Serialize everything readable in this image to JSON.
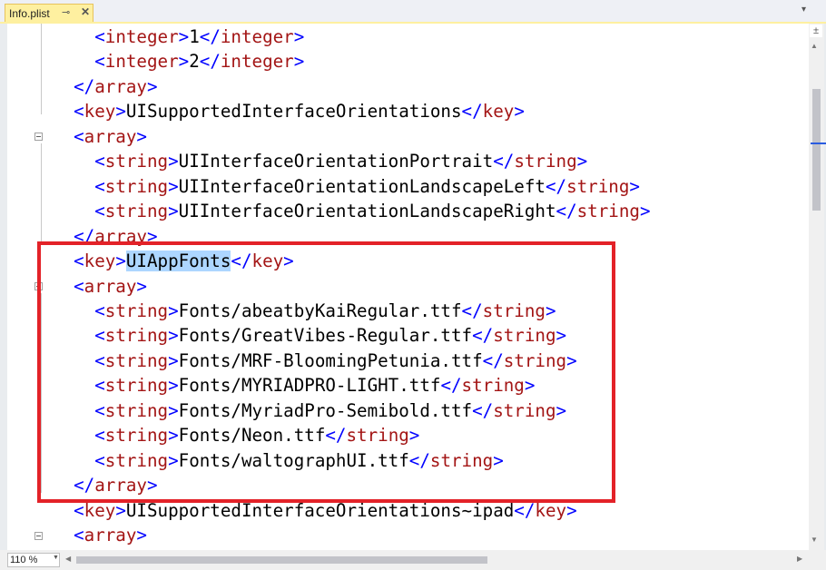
{
  "tab": {
    "title": "Info.plist",
    "pin": "⊸",
    "close": "✕"
  },
  "dropdown": "▾",
  "zoom": {
    "value": "110 %"
  },
  "splitter": "±",
  "code": {
    "lines": [
      [
        [
          "bl",
          "    <"
        ],
        [
          "tg",
          "integer"
        ],
        [
          "bl",
          ">"
        ],
        [
          "tx",
          "1"
        ],
        [
          "bl",
          "</"
        ],
        [
          "tg",
          "integer"
        ],
        [
          "bl",
          ">"
        ]
      ],
      [
        [
          "bl",
          "    <"
        ],
        [
          "tg",
          "integer"
        ],
        [
          "bl",
          ">"
        ],
        [
          "tx",
          "2"
        ],
        [
          "bl",
          "</"
        ],
        [
          "tg",
          "integer"
        ],
        [
          "bl",
          ">"
        ]
      ],
      [
        [
          "bl",
          "  </"
        ],
        [
          "tg",
          "array"
        ],
        [
          "bl",
          ">"
        ]
      ],
      [
        [
          "bl",
          "  <"
        ],
        [
          "tg",
          "key"
        ],
        [
          "bl",
          ">"
        ],
        [
          "tx",
          "UISupportedInterfaceOrientations"
        ],
        [
          "bl",
          "</"
        ],
        [
          "tg",
          "key"
        ],
        [
          "bl",
          ">"
        ]
      ],
      [
        [
          "bl",
          "  <"
        ],
        [
          "tg",
          "array"
        ],
        [
          "bl",
          ">"
        ]
      ],
      [
        [
          "bl",
          "    <"
        ],
        [
          "tg",
          "string"
        ],
        [
          "bl",
          ">"
        ],
        [
          "tx",
          "UIInterfaceOrientationPortrait"
        ],
        [
          "bl",
          "</"
        ],
        [
          "tg",
          "string"
        ],
        [
          "bl",
          ">"
        ]
      ],
      [
        [
          "bl",
          "    <"
        ],
        [
          "tg",
          "string"
        ],
        [
          "bl",
          ">"
        ],
        [
          "tx",
          "UIInterfaceOrientationLandscapeLeft"
        ],
        [
          "bl",
          "</"
        ],
        [
          "tg",
          "string"
        ],
        [
          "bl",
          ">"
        ]
      ],
      [
        [
          "bl",
          "    <"
        ],
        [
          "tg",
          "string"
        ],
        [
          "bl",
          ">"
        ],
        [
          "tx",
          "UIInterfaceOrientationLandscapeRight"
        ],
        [
          "bl",
          "</"
        ],
        [
          "tg",
          "string"
        ],
        [
          "bl",
          ">"
        ]
      ],
      [
        [
          "bl",
          "  </"
        ],
        [
          "tg",
          "array"
        ],
        [
          "bl",
          ">"
        ]
      ],
      [
        [
          "bl",
          "  <"
        ],
        [
          "tg",
          "key"
        ],
        [
          "bl",
          ">"
        ],
        [
          "sel",
          "UIAppFonts"
        ],
        [
          "bl",
          "</"
        ],
        [
          "tg",
          "key"
        ],
        [
          "bl",
          ">"
        ]
      ],
      [
        [
          "bl",
          "  <"
        ],
        [
          "tg",
          "array"
        ],
        [
          "bl",
          ">"
        ]
      ],
      [
        [
          "bl",
          "    <"
        ],
        [
          "tg",
          "string"
        ],
        [
          "bl",
          ">"
        ],
        [
          "tx",
          "Fonts/abeatbyKaiRegular.ttf"
        ],
        [
          "bl",
          "</"
        ],
        [
          "tg",
          "string"
        ],
        [
          "bl",
          ">"
        ]
      ],
      [
        [
          "bl",
          "    <"
        ],
        [
          "tg",
          "string"
        ],
        [
          "bl",
          ">"
        ],
        [
          "tx",
          "Fonts/GreatVibes-Regular.ttf"
        ],
        [
          "bl",
          "</"
        ],
        [
          "tg",
          "string"
        ],
        [
          "bl",
          ">"
        ]
      ],
      [
        [
          "bl",
          "    <"
        ],
        [
          "tg",
          "string"
        ],
        [
          "bl",
          ">"
        ],
        [
          "tx",
          "Fonts/MRF-BloomingPetunia.ttf"
        ],
        [
          "bl",
          "</"
        ],
        [
          "tg",
          "string"
        ],
        [
          "bl",
          ">"
        ]
      ],
      [
        [
          "bl",
          "    <"
        ],
        [
          "tg",
          "string"
        ],
        [
          "bl",
          ">"
        ],
        [
          "tx",
          "Fonts/MYRIADPRO-LIGHT.ttf"
        ],
        [
          "bl",
          "</"
        ],
        [
          "tg",
          "string"
        ],
        [
          "bl",
          ">"
        ]
      ],
      [
        [
          "bl",
          "    <"
        ],
        [
          "tg",
          "string"
        ],
        [
          "bl",
          ">"
        ],
        [
          "tx",
          "Fonts/MyriadPro-Semibold.ttf"
        ],
        [
          "bl",
          "</"
        ],
        [
          "tg",
          "string"
        ],
        [
          "bl",
          ">"
        ]
      ],
      [
        [
          "bl",
          "    <"
        ],
        [
          "tg",
          "string"
        ],
        [
          "bl",
          ">"
        ],
        [
          "tx",
          "Fonts/Neon.ttf"
        ],
        [
          "bl",
          "</"
        ],
        [
          "tg",
          "string"
        ],
        [
          "bl",
          ">"
        ]
      ],
      [
        [
          "bl",
          "    <"
        ],
        [
          "tg",
          "string"
        ],
        [
          "bl",
          ">"
        ],
        [
          "tx",
          "Fonts/waltographUI.ttf"
        ],
        [
          "bl",
          "</"
        ],
        [
          "tg",
          "string"
        ],
        [
          "bl",
          ">"
        ]
      ],
      [
        [
          "bl",
          "  </"
        ],
        [
          "tg",
          "array"
        ],
        [
          "bl",
          ">"
        ]
      ],
      [
        [
          "bl",
          "  <"
        ],
        [
          "tg",
          "key"
        ],
        [
          "bl",
          ">"
        ],
        [
          "tx",
          "UISupportedInterfaceOrientations~ipad"
        ],
        [
          "bl",
          "</"
        ],
        [
          "tg",
          "key"
        ],
        [
          "bl",
          ">"
        ]
      ],
      [
        [
          "bl",
          "  <"
        ],
        [
          "tg",
          "array"
        ],
        [
          "bl",
          ">"
        ]
      ]
    ]
  },
  "colors": {
    "tag_bracket": "#0000ff",
    "tag_name": "#a31515",
    "text": "#000000",
    "selection": "#add6ff",
    "callout": "#e32228"
  }
}
